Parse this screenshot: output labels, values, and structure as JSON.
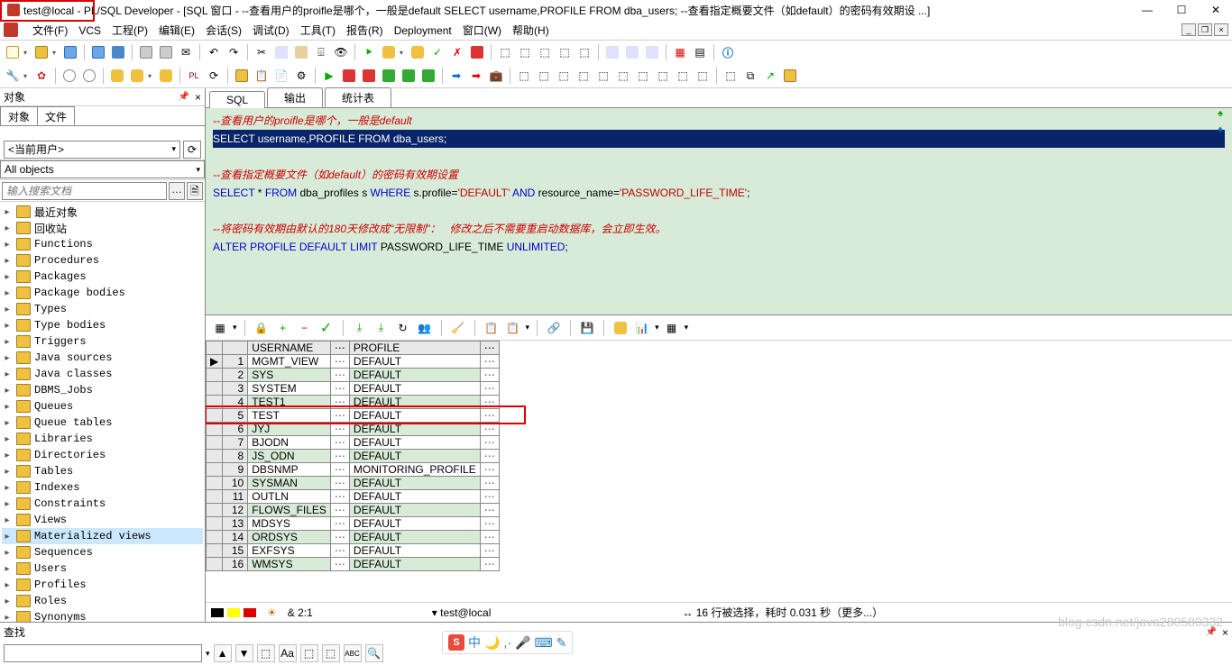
{
  "title": "test@local - PL/SQL Developer - [SQL 窗口 - --查看用户的proifle是哪个，一般是default SELECT username,PROFILE FROM dba_users; --查看指定概要文件（如default）的密码有效期设 ...]",
  "menus": [
    "文件(F)",
    "VCS",
    "工程(P)",
    "编辑(E)",
    "会话(S)",
    "调试(D)",
    "工具(T)",
    "报告(R)",
    "Deployment",
    "窗口(W)",
    "帮助(H)"
  ],
  "left": {
    "panel_title": "对象",
    "tabs": [
      "对象",
      "文件"
    ],
    "user": "<当前用户>",
    "filter": "All objects",
    "search_placeholder": "输入搜索文档",
    "tree": [
      "最近对象",
      "回收站",
      "Functions",
      "Procedures",
      "Packages",
      "Package bodies",
      "Types",
      "Type bodies",
      "Triggers",
      "Java sources",
      "Java classes",
      "DBMS_Jobs",
      "Queues",
      "Queue tables",
      "Libraries",
      "Directories",
      "Tables",
      "Indexes",
      "Constraints",
      "Views",
      "Materialized views",
      "Sequences",
      "Users",
      "Profiles",
      "Roles",
      "Synonyms"
    ],
    "selected_index": 20
  },
  "editor": {
    "tabs": [
      "SQL",
      "输出",
      "统计表"
    ],
    "lines": [
      {
        "t": "comment",
        "s": "--查看用户的proifle是哪个，一般是default"
      },
      {
        "t": "select1",
        "raw": "SELECT username,PROFILE FROM dba_users;"
      },
      {
        "t": "blank",
        "s": ""
      },
      {
        "t": "comment",
        "s": "--查看指定概要文件（如default）的密码有效期设置"
      },
      {
        "t": "select2"
      },
      {
        "t": "blank",
        "s": ""
      },
      {
        "t": "comment",
        "s": "--将密码有效期由默认的180天修改成\"无限制\"：   修改之后不需要重启动数据库，会立即生效。"
      },
      {
        "t": "alter"
      }
    ],
    "select2": {
      "pre": "SELECT * FROM dba_profiles s WHERE s.profile=",
      "s1": "'DEFAULT'",
      "mid": " AND resource_name=",
      "s2": "'PASSWORD_LIFE_TIME'",
      "end": ";"
    },
    "alter": "ALTER PROFILE DEFAULT LIMIT PASSWORD_LIFE_TIME UNLIMITED;"
  },
  "grid": {
    "cols": [
      "USERNAME",
      "PROFILE"
    ],
    "rows": [
      {
        "n": 1,
        "u": "MGMT_VIEW",
        "p": "DEFAULT",
        "ptr": true
      },
      {
        "n": 2,
        "u": "SYS",
        "p": "DEFAULT"
      },
      {
        "n": 3,
        "u": "SYSTEM",
        "p": "DEFAULT"
      },
      {
        "n": 4,
        "u": "TEST1",
        "p": "DEFAULT"
      },
      {
        "n": 5,
        "u": "TEST",
        "p": "DEFAULT",
        "hl": true
      },
      {
        "n": 6,
        "u": "JYJ",
        "p": "DEFAULT"
      },
      {
        "n": 7,
        "u": "BJODN",
        "p": "DEFAULT"
      },
      {
        "n": 8,
        "u": "JS_ODN",
        "p": "DEFAULT"
      },
      {
        "n": 9,
        "u": "DBSNMP",
        "p": "MONITORING_PROFILE"
      },
      {
        "n": 10,
        "u": "SYSMAN",
        "p": "DEFAULT"
      },
      {
        "n": 11,
        "u": "OUTLN",
        "p": "DEFAULT"
      },
      {
        "n": 12,
        "u": "FLOWS_FILES",
        "p": "DEFAULT"
      },
      {
        "n": 13,
        "u": "MDSYS",
        "p": "DEFAULT"
      },
      {
        "n": 14,
        "u": "ORDSYS",
        "p": "DEFAULT"
      },
      {
        "n": 15,
        "u": "EXFSYS",
        "p": "DEFAULT"
      },
      {
        "n": 16,
        "u": "WMSYS",
        "p": "DEFAULT"
      }
    ]
  },
  "status": {
    "pos": "& 2:1",
    "conn": "▾ test@local",
    "msg": "↔ 16 行被选择，耗时 0.031 秒（更多...）"
  },
  "find_label": "查找",
  "watermark": "blog.csdn.net/java280580332",
  "ime": "中"
}
